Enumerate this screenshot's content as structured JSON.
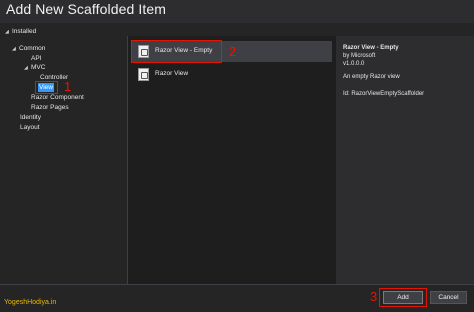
{
  "window": {
    "title": "Add New Scaffolded Item"
  },
  "tree": {
    "installed": "Installed",
    "common": "Common",
    "api": "API",
    "mvc": "MVC",
    "controller": "Controller",
    "view": "View",
    "razor_component": "Razor Component",
    "razor_pages": "Razor Pages",
    "identity": "Identity",
    "layout": "Layout"
  },
  "items": [
    {
      "label": "Razor View - Empty",
      "selected": true
    },
    {
      "label": "Razor View",
      "selected": false
    }
  ],
  "details": {
    "name": "Razor View - Empty",
    "author": "by Microsoft",
    "version": "v1.0.0.0",
    "description": "An empty Razor view",
    "id": "Id: RazorViewEmptyScaffolder"
  },
  "annotations": {
    "one": "1",
    "two": "2",
    "three": "3"
  },
  "buttons": {
    "add": "Add",
    "cancel": "Cancel"
  },
  "watermark": "YogeshHodiya.in",
  "colors": {
    "annotation": "#e51400",
    "selection": "#3399ff",
    "watermark": "#e8b800"
  }
}
